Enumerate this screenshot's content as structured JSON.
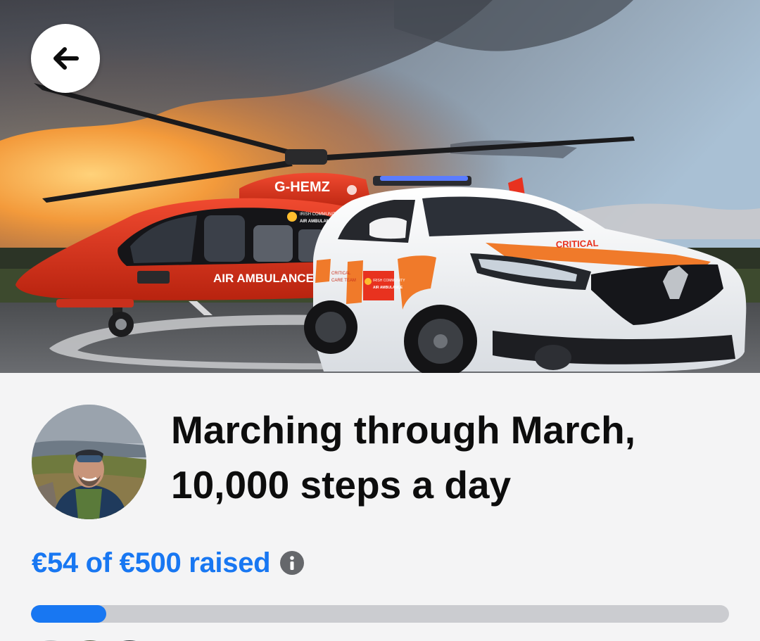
{
  "hero": {
    "helicopter_registration": "G-HEMZ",
    "helicopter_side_text": "AIR AMBULANCE",
    "helicopter_badge_line1": "IRISH COMMUNITY",
    "helicopter_badge_line2": "AIR AMBULANCE",
    "car_door_line1": "CRITICAL",
    "car_door_line2": "CARE TEAM",
    "car_badge_line1": "IRISH COMMUNITY",
    "car_badge_line2": "AIR AMBULANCE",
    "car_bonnet_text": "CRITICAL"
  },
  "back_button": {
    "icon": "arrow-left-icon"
  },
  "fundraiser": {
    "title": "Marching through March, 10,000 steps a day",
    "raised_text": "€54 of €500 raised",
    "raised_amount": 54,
    "goal_amount": 500,
    "info_icon": "info-icon"
  },
  "colors": {
    "accent": "#1877f2",
    "progress_track": "#cbccd0",
    "title_text": "#0d0d0d",
    "info_icon_bg": "#65676b",
    "helicopter_red": "#e8321f",
    "car_orange": "#f07a2a"
  }
}
